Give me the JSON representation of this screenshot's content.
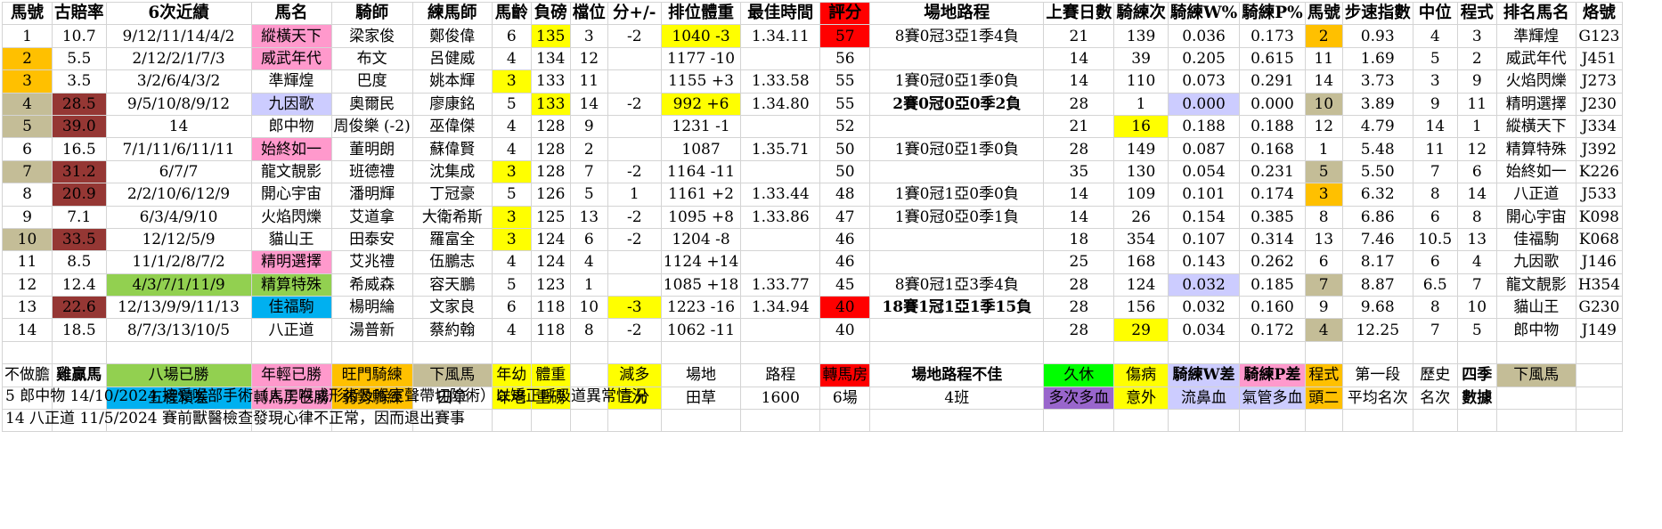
{
  "headers": [
    "馬號",
    "古賠率",
    "6次近績",
    "馬名",
    "騎師",
    "練馬師",
    "馬齡",
    "負磅",
    "檔位",
    "分+/-",
    "排位體重",
    "最佳時間",
    "評分",
    "場地路程",
    "上賽日數",
    "騎練次",
    "騎練W%",
    "騎練P%",
    "馬號",
    "步速指數",
    "中位",
    "程式",
    "排名馬名",
    "烙號"
  ],
  "rows": [
    [
      "1",
      "10.7",
      "9/12/11/14/4/2",
      "縱橫天下",
      "梁家俊",
      "鄭俊偉",
      "6",
      "135",
      "3",
      "-2",
      "1040 -3",
      "1.34.11",
      "57",
      "8賽0冠3亞1季4負",
      "21",
      "139",
      "0.036",
      "0.173",
      "2",
      "0.93",
      "4",
      "3",
      "準輝煌",
      "G123"
    ],
    [
      "2",
      "5.5",
      "2/12/2/1/7/3",
      "威武年代",
      "布文",
      "呂健威",
      "4",
      "134",
      "12",
      "",
      "1177 -10",
      "",
      "56",
      "",
      "14",
      "39",
      "0.205",
      "0.615",
      "11",
      "1.69",
      "5",
      "2",
      "威武年代",
      "J451"
    ],
    [
      "3",
      "3.5",
      "3/2/6/4/3/2",
      "準輝煌",
      "巴度",
      "姚本輝",
      "3",
      "133",
      "11",
      "",
      "1155 +3",
      "1.33.58",
      "55",
      "1賽0冠0亞1季0負",
      "14",
      "110",
      "0.073",
      "0.291",
      "14",
      "3.73",
      "3",
      "9",
      "火焰閃爍",
      "J273"
    ],
    [
      "4",
      "28.5",
      "9/5/10/8/9/12",
      "九因歌",
      "奧爾民",
      "廖康銘",
      "5",
      "133",
      "14",
      "-2",
      "992 +6",
      "1.34.80",
      "55",
      "2賽0冠0亞0季2負",
      "28",
      "1",
      "0.000",
      "0.000",
      "10",
      "3.89",
      "9",
      "11",
      "精明選擇",
      "J230"
    ],
    [
      "5",
      "39.0",
      "14",
      "郎中物",
      "周俊樂 (-2)",
      "巫偉傑",
      "4",
      "128",
      "9",
      "",
      "1231 -1",
      "",
      "52",
      "",
      "21",
      "16",
      "0.188",
      "0.188",
      "12",
      "4.79",
      "14",
      "1",
      "縱橫天下",
      "J334"
    ],
    [
      "6",
      "16.5",
      "7/1/11/6/11/11",
      "始終如一",
      "董明朗",
      "蘇偉賢",
      "4",
      "128",
      "2",
      "",
      "1087",
      "1.35.71",
      "50",
      "1賽0冠0亞1季0負",
      "28",
      "149",
      "0.087",
      "0.168",
      "1",
      "5.48",
      "11",
      "12",
      "精算特殊",
      "J392"
    ],
    [
      "7",
      "31.2",
      "6/7/7",
      "龍文靚影",
      "班德禮",
      "沈集成",
      "3",
      "128",
      "7",
      "-2",
      "1164 -11",
      "",
      "50",
      "",
      "35",
      "130",
      "0.054",
      "0.231",
      "5",
      "5.50",
      "7",
      "6",
      "始終如一",
      "K226"
    ],
    [
      "8",
      "20.9",
      "2/2/10/6/12/9",
      "開心宇宙",
      "潘明輝",
      "丁冠豪",
      "5",
      "126",
      "5",
      "1",
      "1161 +2",
      "1.33.44",
      "48",
      "1賽0冠1亞0季0負",
      "14",
      "109",
      "0.101",
      "0.174",
      "3",
      "6.32",
      "8",
      "14",
      "八正道",
      "J533"
    ],
    [
      "9",
      "7.1",
      "6/3/4/9/10",
      "火焰閃爍",
      "艾道拿",
      "大衛希斯",
      "3",
      "125",
      "13",
      "-2",
      "1095 +8",
      "1.33.86",
      "47",
      "1賽0冠0亞0季1負",
      "14",
      "26",
      "0.154",
      "0.385",
      "8",
      "6.86",
      "6",
      "8",
      "開心宇宙",
      "K098"
    ],
    [
      "10",
      "33.5",
      "12/12/5/9",
      "貓山王",
      "田泰安",
      "羅富全",
      "3",
      "124",
      "6",
      "-2",
      "1204 -8",
      "",
      "46",
      "",
      "18",
      "354",
      "0.107",
      "0.314",
      "13",
      "7.46",
      "10.5",
      "13",
      "佳福駒",
      "K068"
    ],
    [
      "11",
      "8.5",
      "11/1/2/8/7/2",
      "精明選擇",
      "艾兆禮",
      "伍鵬志",
      "4",
      "124",
      "4",
      "",
      "1124 +14",
      "",
      "46",
      "",
      "25",
      "168",
      "0.143",
      "0.262",
      "6",
      "8.17",
      "6",
      "4",
      "九因歌",
      "J146"
    ],
    [
      "12",
      "12.4",
      "4/3/7/1/11/9",
      "精算特殊",
      "希威森",
      "容天鵬",
      "5",
      "123",
      "1",
      "",
      "1085 +18",
      "1.33.77",
      "45",
      "8賽0冠1亞3季4負",
      "28",
      "124",
      "0.032",
      "0.185",
      "7",
      "8.87",
      "6.5",
      "7",
      "龍文靚影",
      "H354"
    ],
    [
      "13",
      "22.6",
      "12/13/9/9/11/13",
      "佳福駒",
      "楊明綸",
      "文家良",
      "6",
      "118",
      "10",
      "-3",
      "1223 -16",
      "1.34.94",
      "40",
      "18賽1冠1亞1季15負",
      "28",
      "156",
      "0.032",
      "0.160",
      "9",
      "9.68",
      "8",
      "10",
      "貓山王",
      "G230"
    ],
    [
      "14",
      "18.5",
      "8/7/3/13/10/5",
      "八正道",
      "湯普新",
      "蔡約翰",
      "4",
      "118",
      "8",
      "-2",
      "1062 -11",
      "",
      "40",
      "",
      "28",
      "29",
      "0.034",
      "0.172",
      "4",
      "12.25",
      "7",
      "5",
      "郎中物",
      "J149"
    ]
  ],
  "legend": {
    "row1": [
      "不做膽",
      "雞贏馬",
      "八場已勝",
      "年輕已勝",
      "旺門騎練",
      "下風馬",
      "年幼",
      "體重",
      "減多",
      "場地",
      "路程",
      "轉馬房",
      "場地路程不佳",
      "久休",
      "傷病",
      "騎練W差",
      "騎練P差",
      "程式",
      "第一段",
      "歷史",
      "四季",
      "下風馬"
    ],
    "row2": [
      "五程積差",
      "轉馬房已勝",
      "弱勢騎練",
      "田草",
      "年老",
      "重磅",
      "三分",
      "田草",
      "1600",
      "6場",
      "4班",
      "多次多血",
      "意外",
      "流鼻血",
      "氣管多血",
      "頭二",
      "平均名次",
      "名次",
      "數據"
    ]
  },
  "notes": [
    "5 郎中物  14/10/2024  接受喉部手術（人工喉成形術及喉室聲帶切除術）以矯正呼吸道異常情況",
    "14 八正道  11/5/2024  賽前獸醫檢查發現心律不正常，因而退出賽事"
  ],
  "colors": {
    "yellow": "#ffff00",
    "orange": "#ffc000",
    "pink": "#ff99cc",
    "blue": "#00b0f0",
    "khaki": "#c4bd97",
    "darkred": "#953734",
    "red": "#ff0000",
    "lavender": "#ccccff",
    "green": "#92d050",
    "lime": "#00ff00",
    "purple": "#9966cc",
    "text_blue": "#1a1aff"
  }
}
